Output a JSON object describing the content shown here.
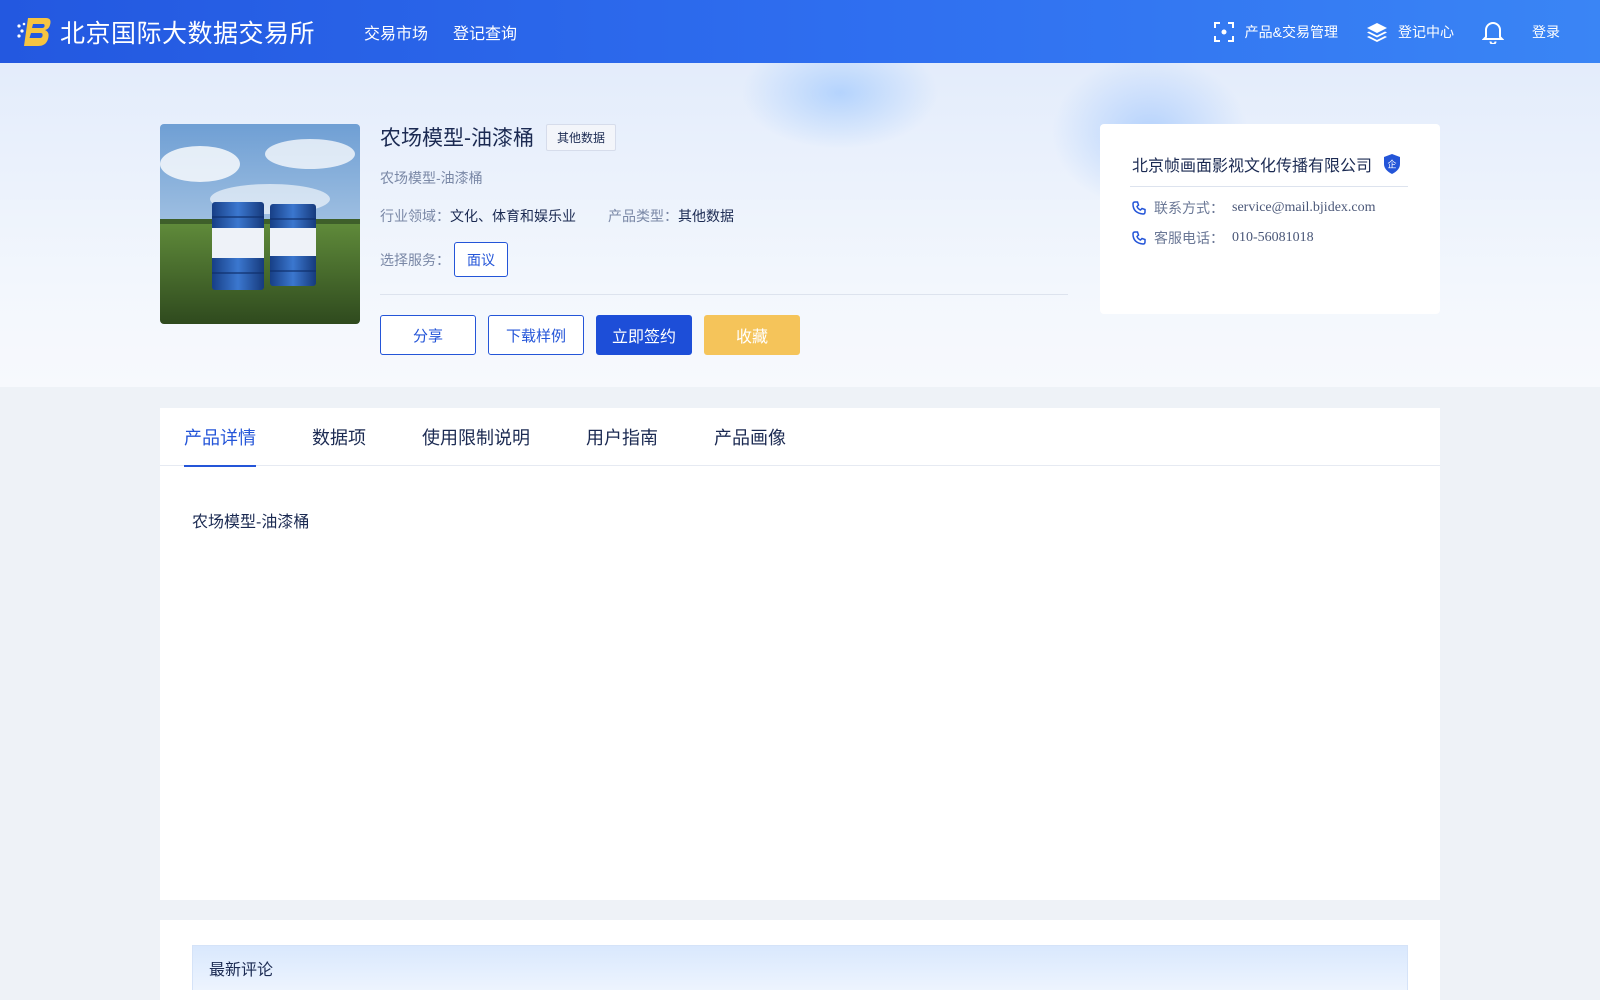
{
  "header": {
    "logo_text": "北京国际大数据交易所",
    "nav": [
      "交易市场",
      "登记查询"
    ],
    "tools": {
      "product_mgmt": "产品&交易管理",
      "register_center": "登记中心",
      "login": "登录"
    }
  },
  "product": {
    "title": "农场模型-油漆桶",
    "tag": "其他数据",
    "subtitle": "农场模型-油漆桶",
    "industry_label": "行业领域：",
    "industry_value": "文化、体育和娱乐业",
    "type_label": "产品类型：",
    "type_value": "其他数据",
    "service_label": "选择服务：",
    "service_option": "面议",
    "actions": {
      "share": "分享",
      "download_sample": "下载样例",
      "sign_now": "立即签约",
      "favorite": "收藏"
    }
  },
  "company": {
    "name": "北京帧画面影视文化传播有限公司",
    "badge": "企",
    "contact_label": "联系方式：",
    "contact_value": "service@mail.bjidex.com",
    "phone_label": "客服电话：",
    "phone_value": "010-56081018"
  },
  "tabs": [
    {
      "label": "产品详情",
      "active": true
    },
    {
      "label": "数据项",
      "active": false
    },
    {
      "label": "使用限制说明",
      "active": false
    },
    {
      "label": "用户指南",
      "active": false
    },
    {
      "label": "产品画像",
      "active": false
    }
  ],
  "detail_text": "农场模型-油漆桶",
  "comments": {
    "title": "最新评论"
  },
  "colors": {
    "primary": "#1d4ed8",
    "header_start": "#2358e0",
    "header_end": "#3a85f5",
    "favorite": "#f5c45a"
  }
}
